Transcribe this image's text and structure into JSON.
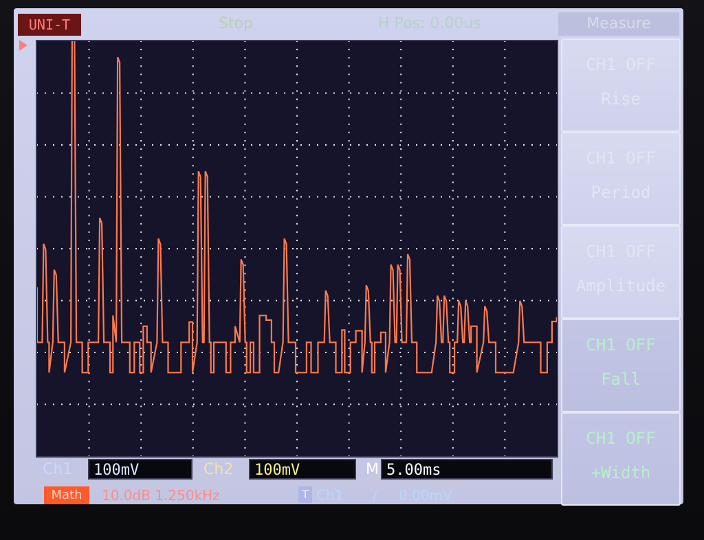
{
  "top_bar": {
    "brand": "UNI-T",
    "status": "Stop",
    "horizontal_position": "H Pos: 0.00us"
  },
  "menu": {
    "title": "Measure",
    "items": [
      {
        "line1": "CH1  OFF",
        "line2": "Rise"
      },
      {
        "line1": "CH1  OFF",
        "line2": "Period"
      },
      {
        "line1": "CH1  OFF",
        "line2": "Amplitude"
      },
      {
        "line1": "CH1  OFF",
        "line2": "Fall"
      },
      {
        "line1": "CH1  OFF",
        "line2": "+Width"
      }
    ]
  },
  "bottom": {
    "ch1_label": "Ch1",
    "ch1_scale": "100mV",
    "ch2_label": "Ch2",
    "ch2_scale": "100mV",
    "time_label": "M",
    "time_scale": "5.00ms",
    "math_label": "Math",
    "math_info": "10.0dB 1.250kHz",
    "trigger_badge": "T",
    "trigger_source": "Ch1",
    "trigger_slope": "/",
    "trigger_level": "0.00mV"
  },
  "colors": {
    "trace": "#ff7a4e",
    "grid": "#e8f0ff",
    "plot_bg": "#16142a"
  },
  "chart_data": {
    "type": "line",
    "divisions": {
      "x": 10,
      "y": 8
    },
    "peak_positions_div": [
      0.1,
      0.35,
      0.7,
      1.2,
      1.55,
      2.35,
      3.15,
      3.95,
      4.75,
      5.55,
      6.35,
      6.85,
      7.15,
      7.75,
      8.15,
      8.55,
      9.25
    ],
    "peak_heights_div": [
      1.9,
      1.4,
      6.5,
      2.4,
      5.5,
      2.0,
      3.3,
      1.6,
      2.0,
      1.0,
      1.1,
      1.5,
      1.7,
      0.9,
      0.8,
      0.7,
      0.8
    ],
    "baseline_div": 1.4
  }
}
